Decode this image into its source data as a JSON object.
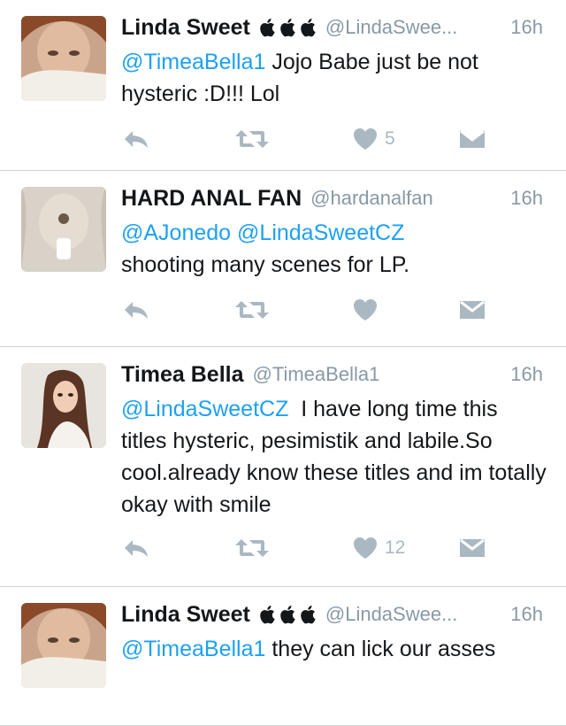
{
  "tweets": [
    {
      "name": "Linda Sweet",
      "apple_badges": 3,
      "handle": "@LindaSwee...",
      "time": "16h",
      "mentions": [
        "@TimeaBella1"
      ],
      "text": " Jojo Babe just be not hysteric :D!!! Lol",
      "like_count": "5"
    },
    {
      "name": "HARD ANAL FAN",
      "apple_badges": 0,
      "handle": "@hardanalfan",
      "time": "16h",
      "mentions": [
        "@AJonedo",
        " ",
        "@LindaSweetCZ"
      ],
      "text": " shooting many scenes for LP.",
      "like_count": ""
    },
    {
      "name": "Timea Bella",
      "apple_badges": 0,
      "handle": "@TimeaBella1",
      "time": "16h",
      "mentions": [
        "@LindaSweetCZ"
      ],
      "text": "  I have long time this titles hysteric, pesimistik and labile.So cool.already know these titles and im totally okay with smile",
      "like_count": "12"
    },
    {
      "name": "Linda Sweet",
      "apple_badges": 3,
      "handle": "@LindaSwee...",
      "time": "16h",
      "mentions": [
        "@TimeaBella1"
      ],
      "text": " they can lick our asses",
      "like_count": ""
    }
  ],
  "icons": {
    "reply": "reply-icon",
    "retweet": "retweet-icon",
    "like": "heart-icon",
    "dm": "direct-message-icon",
    "badge": "apple-icon"
  },
  "colors": {
    "mention": "#1da1f2",
    "meta": "#8899a6",
    "action": "#aab8c2",
    "divider": "#cfd4d8"
  }
}
